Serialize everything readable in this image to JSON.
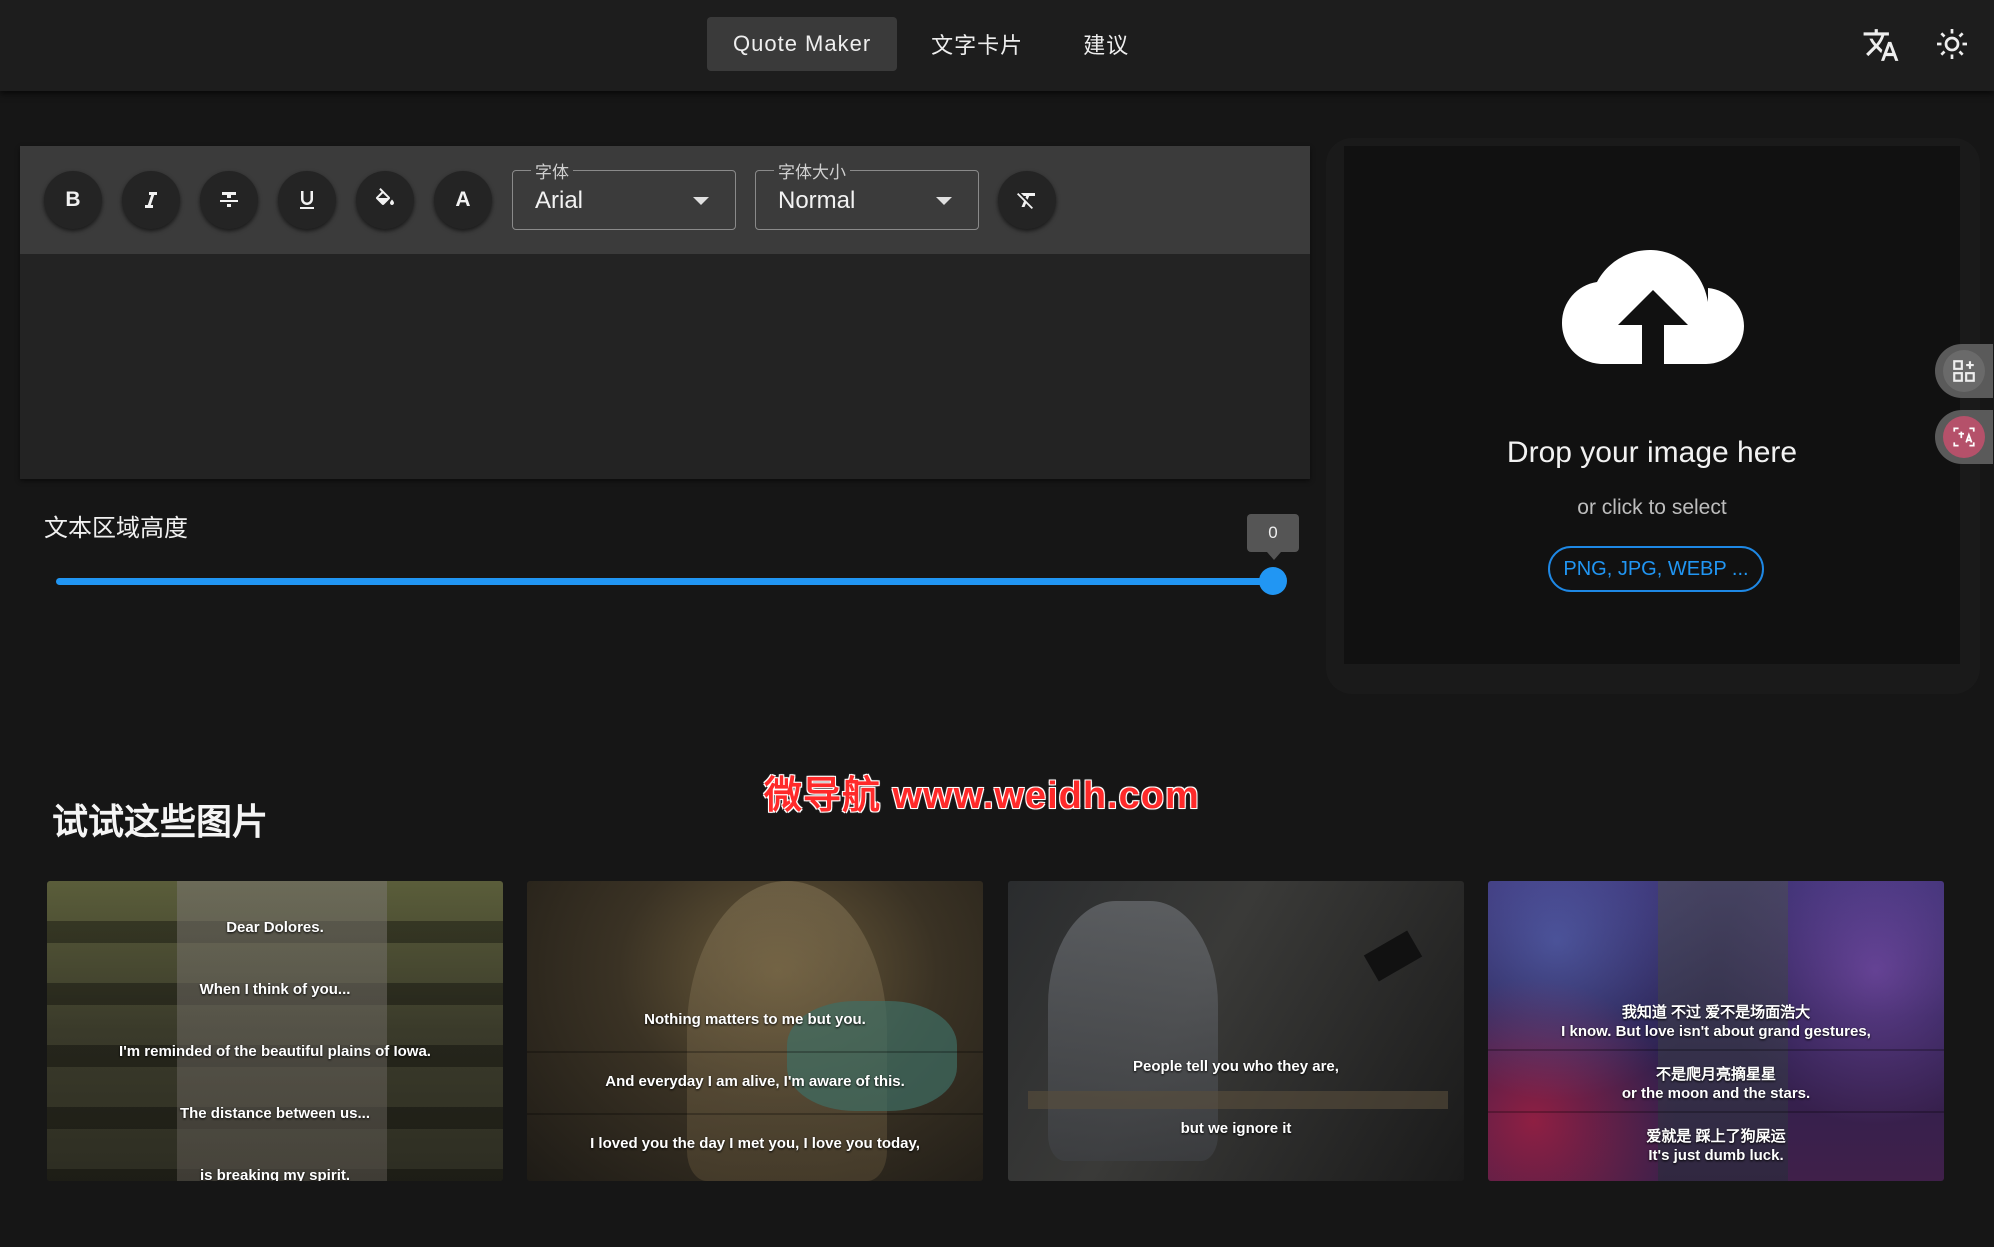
{
  "nav": {
    "tabs": [
      {
        "label": "Quote Maker",
        "active": true
      },
      {
        "label": "文字卡片",
        "active": false
      },
      {
        "label": "建议",
        "active": false
      }
    ],
    "icons": [
      "translate-icon",
      "brightness-icon"
    ]
  },
  "toolbar": {
    "bold": "B",
    "text_color": "A",
    "font": {
      "label": "字体",
      "value": "Arial"
    },
    "size": {
      "label": "字体大小",
      "value": "Normal"
    }
  },
  "textarea_height": {
    "label": "文本区域高度",
    "value": "0"
  },
  "dropzone": {
    "title": "Drop your image here",
    "subtitle": "or click to select",
    "formats": "PNG, JPG, WEBP ..."
  },
  "gallery": {
    "title": "试试这些图片",
    "watermark": "微导航 www.weidh.com",
    "cards": [
      {
        "lines": [
          "Dear Dolores.",
          "When I think of you...",
          "I'm reminded of the beautiful plains of Iowa.",
          "The distance between us...",
          "is breaking my spirit."
        ]
      },
      {
        "lines": [
          "Nothing matters to me but you.",
          "And everyday I am alive, I'm aware of this.",
          "I loved you the day I met you, I love you today,"
        ]
      },
      {
        "lines": [
          "People tell you who they are,",
          "but we ignore it"
        ]
      },
      {
        "lines": [
          "我知道 不过 爱不是场面浩大",
          "I know. But love isn't about grand gestures,",
          "不是爬月亮摘星星",
          "or the moon and the stars.",
          "爱就是 踩上了狗屎运",
          "It's just dumb luck."
        ]
      }
    ]
  },
  "colors": {
    "accent": "#2196f3",
    "watermark": "#ff2a2a"
  }
}
